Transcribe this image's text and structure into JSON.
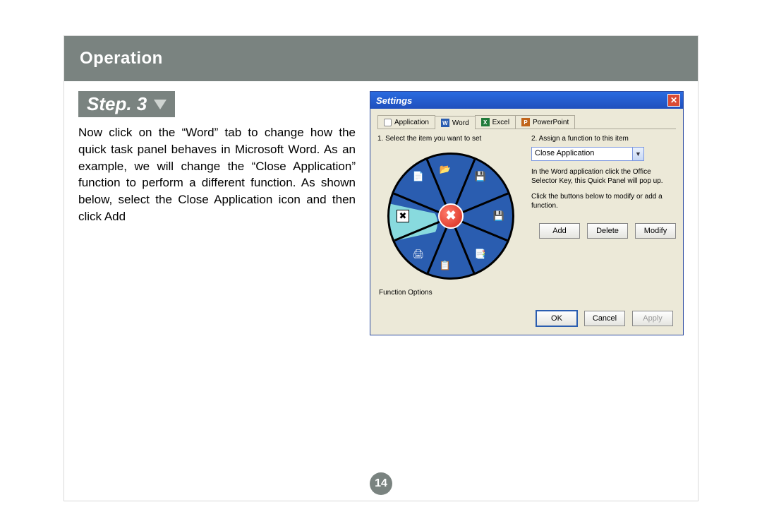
{
  "header": {
    "title": "Operation"
  },
  "step": {
    "label": "Step. 3"
  },
  "body_text": "Now click on the “Word” tab to change how the quick task panel behaves in Microsoft Word.  As an example, we will change the “Close Application” function to perform a different function. As shown below, select the Close Application icon and then click Add",
  "page_number": "14",
  "dialog": {
    "title": "Settings",
    "tabs": {
      "application": "Application",
      "word": "Word",
      "excel": "Excel",
      "powerpoint": "PowerPoint"
    },
    "labels": {
      "select_item": "1. Select the item you want to set",
      "assign_fn": "2. Assign a function to this item",
      "function_options": "Function Options"
    },
    "dropdown_value": "Close Application",
    "hint1": "In the Word application click the Office Selector Key, this Quick Panel will pop up.",
    "hint2": "Click the buttons below to modify or add a function.",
    "buttons": {
      "add": "Add",
      "delete": "Delete",
      "modify": "Modify",
      "ok": "OK",
      "cancel": "Cancel",
      "apply": "Apply"
    }
  }
}
